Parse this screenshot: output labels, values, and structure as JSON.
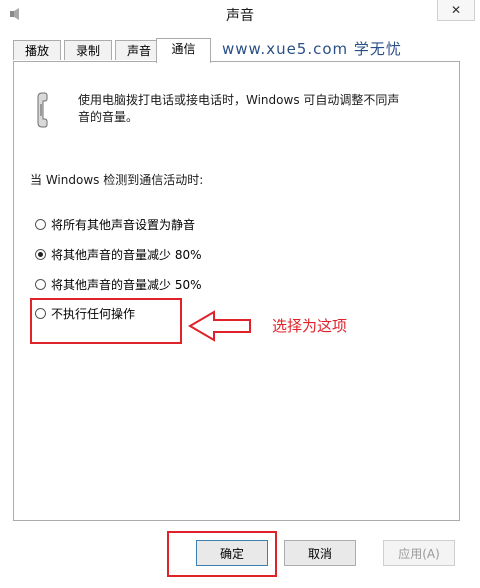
{
  "window": {
    "title": "声音",
    "close_glyph": "✕"
  },
  "tabs": [
    {
      "label": "播放"
    },
    {
      "label": "录制"
    },
    {
      "label": "声音"
    },
    {
      "label": "通信",
      "active": true
    }
  ],
  "watermark": "www.xue5.com 学无忧",
  "communications": {
    "icon": "phone-handset-icon",
    "description": "使用电脑拨打电话或接电话时，Windows 可自动调整不同声音的音量。",
    "when_label": "当 Windows 检测到通信活动时:",
    "options": [
      {
        "label": "将所有其他声音设置为静音",
        "checked": false
      },
      {
        "label": "将其他声音的音量减少 80%",
        "checked": true
      },
      {
        "label": "将其他声音的音量减少 50%",
        "checked": false
      },
      {
        "label": "不执行任何操作",
        "checked": false
      }
    ]
  },
  "annotation": {
    "text": "选择为这项",
    "color": "#e0232a"
  },
  "buttons": {
    "ok": "确定",
    "cancel": "取消",
    "apply": "应用(A)"
  }
}
